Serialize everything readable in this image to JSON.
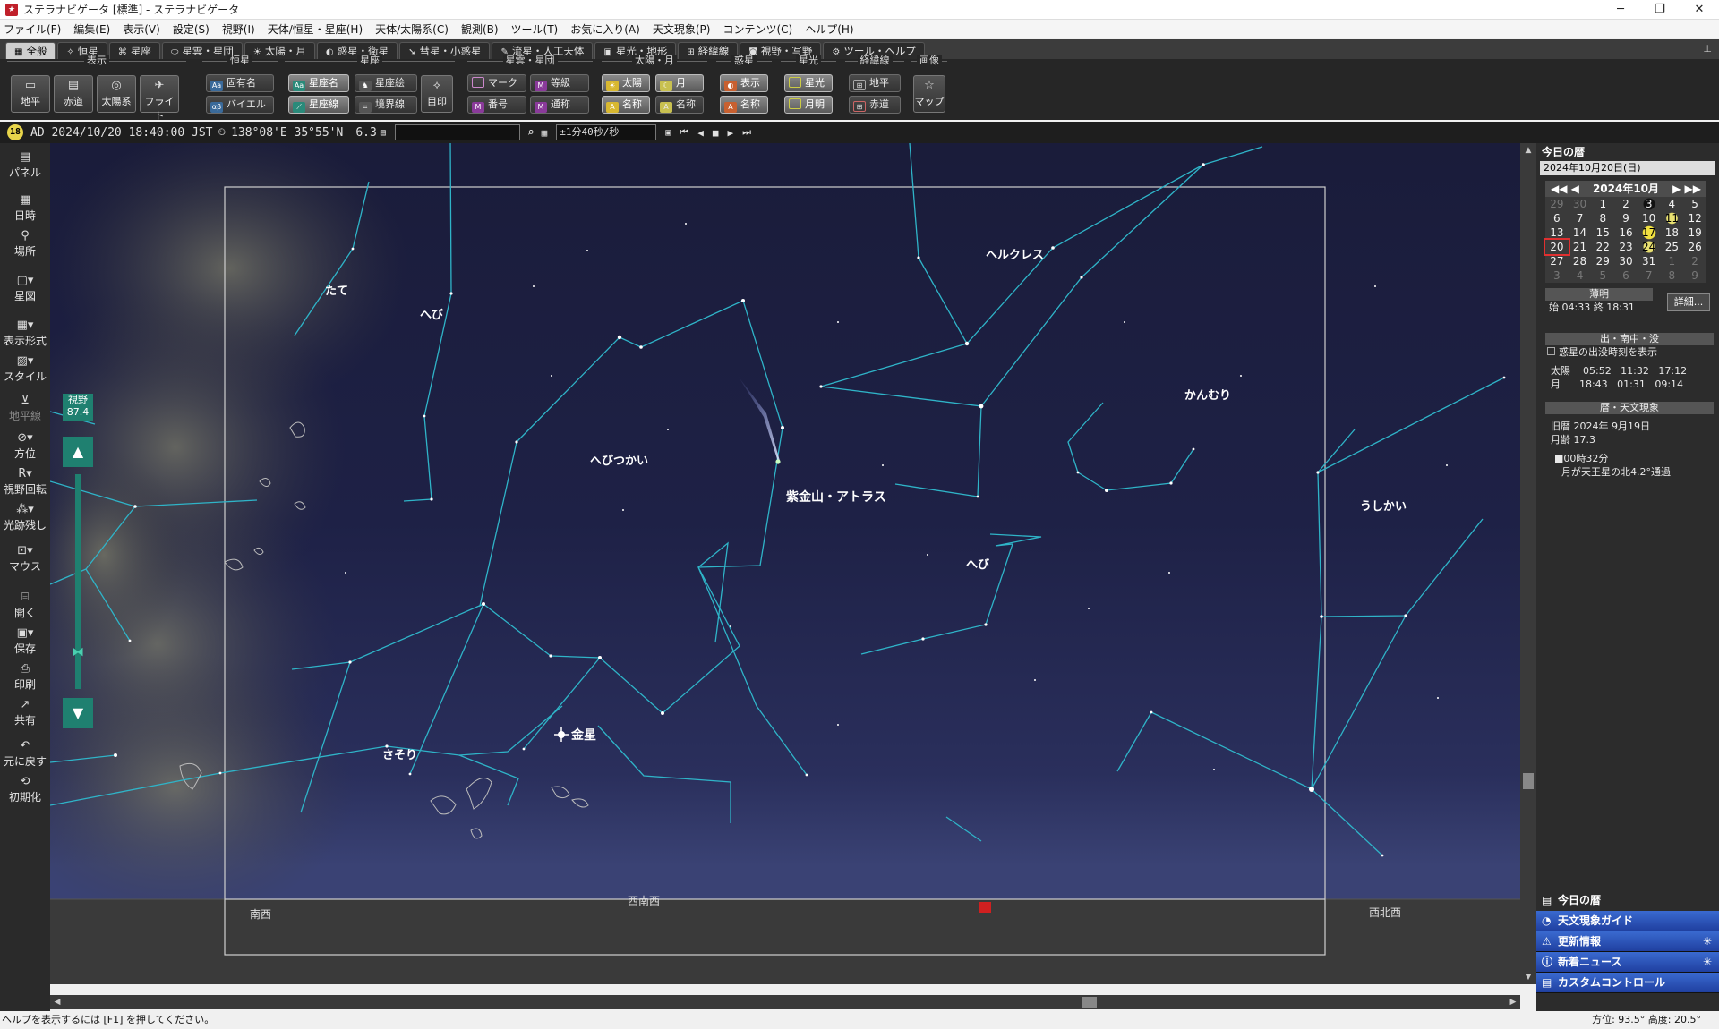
{
  "window": {
    "title": "ステラナビゲータ [標準] - ステラナビゲータ",
    "icon": "stella-app-icon",
    "minimize": "─",
    "maximize": "❐",
    "close": "✕"
  },
  "menu": [
    "ファイル(F)",
    "編集(E)",
    "表示(V)",
    "設定(S)",
    "視野(I)",
    "天体/恒星・星座(H)",
    "天体/太陽系(C)",
    "観測(B)",
    "ツール(T)",
    "お気に入り(A)",
    "天文現象(P)",
    "コンテンツ(C)",
    "ヘルプ(H)"
  ],
  "tabs": [
    {
      "label": "全般",
      "icon": "grid-icon",
      "active": true
    },
    {
      "label": "恒星",
      "icon": "star-icon"
    },
    {
      "label": "星座",
      "icon": "constellation-icon"
    },
    {
      "label": "星雲・星団",
      "icon": "nebula-icon"
    },
    {
      "label": "太陽・月",
      "icon": "sun-icon"
    },
    {
      "label": "惑星・衛星",
      "icon": "planet-icon"
    },
    {
      "label": "彗星・小惑星",
      "icon": "comet-icon"
    },
    {
      "label": "流星・人工天体",
      "icon": "meteor-icon"
    },
    {
      "label": "星光・地形",
      "icon": "terrain-icon"
    },
    {
      "label": "経緯線",
      "icon": "grid-lines-icon"
    },
    {
      "label": "視野・写野",
      "icon": "field-icon"
    },
    {
      "label": "ツール・ヘルプ",
      "icon": "gear-icon"
    }
  ],
  "ribbon": {
    "groups": {
      "display": "表示",
      "stars": "恒星",
      "constellations": "星座",
      "nebulae": "星雲・星団",
      "sunmoon": "太陽・月",
      "planets": "惑星",
      "starlight": "星光",
      "gridlines": "経緯線",
      "image": "画像"
    },
    "display_buttons": [
      "地平",
      "赤道",
      "太陽系",
      "フライト"
    ],
    "star_buttons": [
      "固有名",
      "バイエル"
    ],
    "constellation_buttons": [
      "星座名",
      "星座絵",
      "星座線",
      "境界線"
    ],
    "constellation_big": "目印",
    "nebula_buttons": [
      "マーク",
      "等級",
      "番号",
      "通称"
    ],
    "sunmoon_buttons": [
      "太陽",
      "月",
      "名称",
      "名称"
    ],
    "planet_buttons": [
      "表示",
      "名称"
    ],
    "starlight_buttons": [
      "星光",
      "月明"
    ],
    "grid_buttons": [
      "地平",
      "赤道"
    ],
    "image_button": "マップ"
  },
  "infobar": {
    "badge": "18",
    "datetime": "AD 2024/10/20 18:40:00 JST",
    "location": "138°08'E 35°55'N",
    "magnitude": "6.3",
    "search_value": "",
    "step": "±1分40秒/秒"
  },
  "leftbar": {
    "items": [
      "パネル",
      "日時",
      "場所",
      "星図",
      "表示形式",
      "スタイル",
      "地平線",
      "方位",
      "視野回転",
      "光跡残し",
      "マウス",
      "開く",
      "保存",
      "印刷",
      "共有",
      "元に戻す",
      "初期化"
    ],
    "fov_label": "視野",
    "fov_value": "87.4"
  },
  "sky": {
    "labels": {
      "tate": "たて",
      "hebi1": "へび",
      "hercules": "ヘルクレス",
      "kanmuri": "かんむり",
      "hebitsukai": "へびつかい",
      "comet": "紫金山・アトラス",
      "hebi2": "へび",
      "ushikai": "うしかい",
      "sasori": "さそり",
      "venus": "金星"
    },
    "horizon": {
      "sw": "南西",
      "wsw": "西南西",
      "wnw": "西北西"
    }
  },
  "rightpanel": {
    "title": "今日の暦",
    "date": "2024年10月20日(日)",
    "calendar": {
      "month_label": "2024年10月",
      "weeks": [
        [
          "29",
          "30",
          "1",
          "2",
          "3",
          "4",
          "5"
        ],
        [
          "6",
          "7",
          "8",
          "9",
          "10",
          "11",
          "12"
        ],
        [
          "13",
          "14",
          "15",
          "16",
          "17",
          "18",
          "19"
        ],
        [
          "20",
          "21",
          "22",
          "23",
          "24",
          "25",
          "26"
        ],
        [
          "27",
          "28",
          "29",
          "30",
          "31",
          "1",
          "2"
        ],
        [
          "3",
          "4",
          "5",
          "6",
          "7",
          "8",
          "9"
        ]
      ]
    },
    "twilight_title": "薄明",
    "twilight": "始 04:33  終 18:31",
    "detail_button": "詳細...",
    "riseset_title": "出・南中・没",
    "planet_checkbox": "惑星の出没時刻を表示",
    "sun": "太陽    05:52   11:32   17:12",
    "moon": "月      18:43   01:31   09:14",
    "calendar_title": "暦・天文現象",
    "lunar1": "旧暦  2024年 9月19日",
    "lunar2": "月齢  17.3",
    "event1": "■00時32分",
    "event2": "月が天王星の北4.2°通過",
    "links": [
      "今日の暦",
      "天文現象ガイド",
      "更新情報",
      "新着ニュース",
      "カスタムコントロール"
    ]
  },
  "statusbar": {
    "help": "ヘルプを表示するには [F1] を押してください。",
    "coords": "方位:  93.5°  高度:  20.5°"
  }
}
